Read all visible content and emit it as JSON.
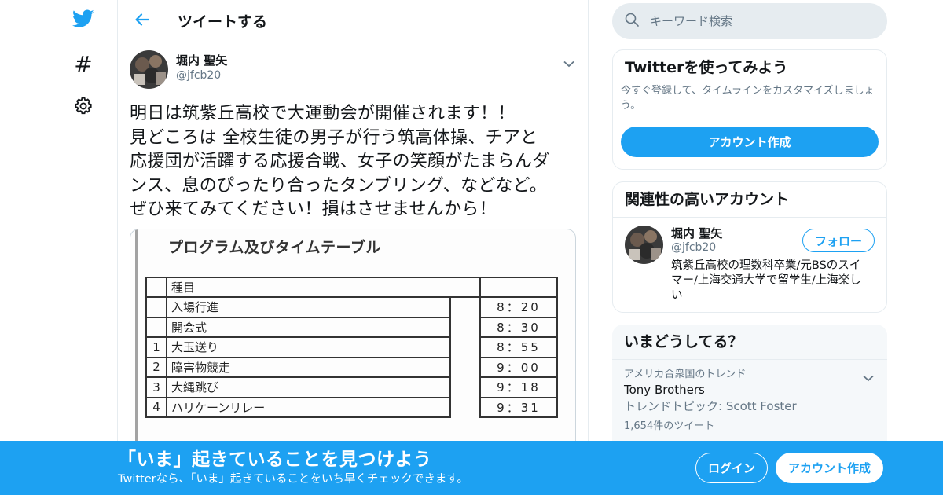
{
  "nav": {
    "brand_icon": "twitter-bird-icon",
    "items": [
      {
        "icon": "hashtag-icon",
        "label": "#"
      },
      {
        "icon": "gear-icon"
      }
    ]
  },
  "header": {
    "title": "ツイートする"
  },
  "tweet": {
    "author_name": "堀内 聖矢",
    "author_handle": "@jfcb20",
    "text_lines": [
      "明日は筑紫丘高校で大運動会が開催されます！！",
      "見どころは 全校生徒の男子が行う筑高体操、チアと",
      "応援団が活躍する応援合戦、女子の笑顔がたまらんダ",
      "ンス、息のぴったり合ったタンブリング、などなど。",
      "ぜひ来てみてください！損はさせませんから！"
    ],
    "media": {
      "title": "プログラム及びタイムテーブル",
      "header_label": "種目",
      "rows": [
        {
          "num": "",
          "event": "入場行進",
          "time": "8：20"
        },
        {
          "num": "",
          "event": "開会式",
          "time": "8：30"
        },
        {
          "num": "1",
          "event": "大玉送り",
          "time": "8：55"
        },
        {
          "num": "2",
          "event": "障害物競走",
          "time": "9：00"
        },
        {
          "num": "3",
          "event": "大縄跳び",
          "time": "9：18"
        },
        {
          "num": "4",
          "event": "ハリケーンリレー",
          "time": "9：31"
        }
      ]
    }
  },
  "search": {
    "placeholder": "キーワード検索"
  },
  "signup_card": {
    "title": "Twitterを使ってみよう",
    "description": "今すぐ登録して、タイムラインをカスタマイズしましょう。",
    "button": "アカウント作成"
  },
  "related": {
    "title": "関連性の高いアカウント",
    "account": {
      "name": "堀内 聖矢",
      "handle": "@jfcb20",
      "follow_label": "フォロー",
      "bio": "筑紫丘高校の理数科卒業/元BSのスイマー/上海交通大学で留学生/上海楽しい"
    }
  },
  "trends": {
    "title": "いまどうしてる？",
    "items": [
      {
        "context": "アメリカ合衆国のトレンド",
        "name": "Tony Brothers",
        "topic": "トレンドトピック: Scott Foster",
        "count": "1,654件のツイート"
      }
    ]
  },
  "bottom_bar": {
    "headline": "「いま」起きていることを見つけよう",
    "subtext": "Twitterなら、「いま」起きていることをいち早くチェックできます。",
    "login": "ログイン",
    "signup": "アカウント作成"
  },
  "colors": {
    "brand": "#1da1f2",
    "text": "#14171a",
    "muted": "#657786",
    "border": "#e6ecf0"
  }
}
